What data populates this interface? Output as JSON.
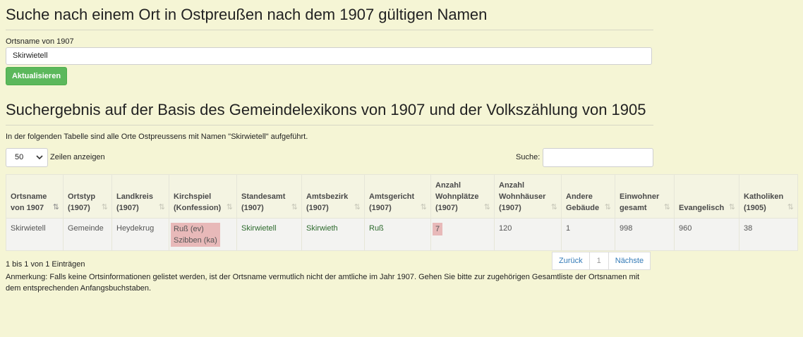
{
  "page": {
    "title": "Suche nach einem Ort in Ostpreußen nach dem 1907 gültigen Namen",
    "results_title": "Suchergebnis auf der Basis des Gemeindelexikons von 1907 und der Volkszählung von 1905"
  },
  "form": {
    "label": "Ortsname von 1907",
    "value": "Skirwietell",
    "submit_label": "Aktualisieren"
  },
  "description": "In der folgenden Tabelle sind alle Orte Ostpreussens mit Namen \"Skirwietell\" aufgeführt.",
  "table_controls": {
    "length_value": "50",
    "length_label": "Zeilen anzeigen",
    "search_label": "Suche:"
  },
  "table": {
    "columns": [
      [
        "Ortsname",
        "von 1907"
      ],
      [
        "Ortstyp",
        "(1907)"
      ],
      [
        "Landkreis",
        "(1907)"
      ],
      [
        "Kirchspiel",
        "(Konfession)"
      ],
      [
        "Standesamt",
        "(1907)"
      ],
      [
        "Amtsbezirk",
        "(1907)"
      ],
      [
        "Amtsgericht",
        "(1907)"
      ],
      [
        "Anzahl",
        "Wohnplätze",
        "(1907)"
      ],
      [
        "Anzahl",
        "Wohnhäuser",
        "(1907)"
      ],
      [
        "Andere",
        "Gebäude"
      ],
      [
        "Einwohner",
        "gesamt"
      ],
      [
        "Evangelisch"
      ],
      [
        "Katholiken",
        "(1905)"
      ]
    ],
    "rows": [
      {
        "ortsname": "Skirwietell",
        "ortstyp": "Gemeinde",
        "landkreis": "Heydekrug",
        "kirchspiel_1": "Ruß (ev)",
        "kirchspiel_2": "Szibben (ka)",
        "standesamt": "Skirwietell",
        "amtsbezirk": "Skirwieth",
        "amtsgericht": "Ruß",
        "wohnplaetze": "7",
        "wohnhaeuser": "120",
        "andere": "1",
        "einwohner": "998",
        "evangelisch": "960",
        "katholiken": "38"
      }
    ]
  },
  "pagination": {
    "info": "1 bis 1 von 1 Einträgen",
    "prev": "Zurück",
    "current": "1",
    "next": "Nächste"
  },
  "note": "Anmerkung: Falls keine Ortsinformationen gelistet werden, ist der Ortsname vermutlich nicht der amtliche im Jahr 1907. Gehen Sie bitte zur zugehörigen Gesamtliste der Ortsnamen mit dem entsprechenden Anfangsbuchstaben.",
  "icons": {
    "sort_icon": "sort-icon",
    "sort_asc_icon": "sort-asc-icon",
    "dropdown_icon": "chevron-down-icon"
  }
}
